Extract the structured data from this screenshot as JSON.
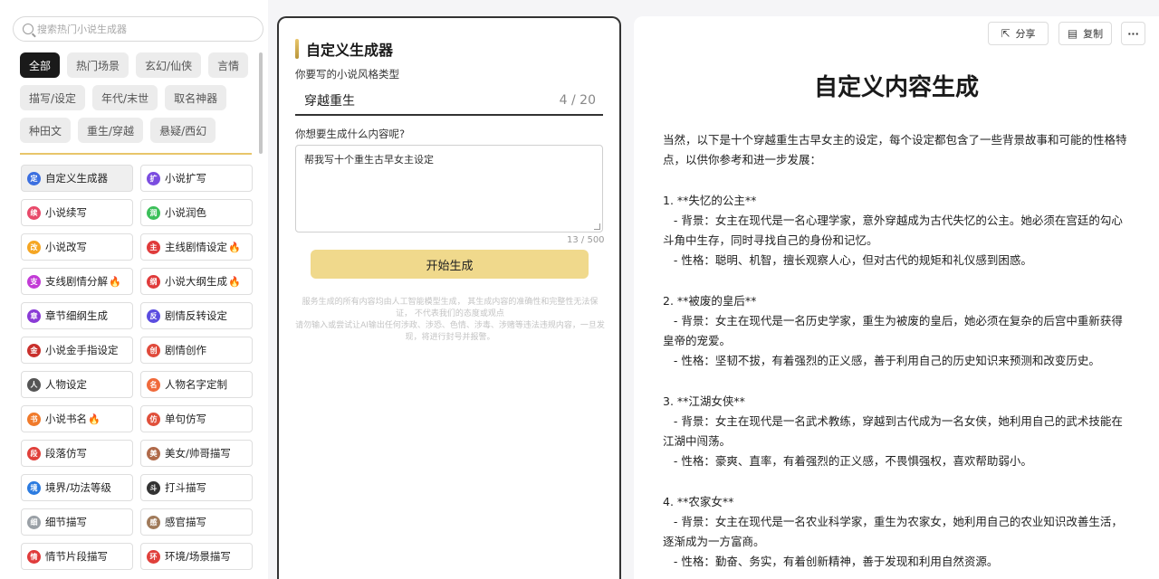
{
  "search": {
    "placeholder": "搜索热门小说生成器"
  },
  "categories": [
    [
      "全部",
      "热门场景",
      "玄幻/仙侠",
      "言情"
    ],
    [
      "描写/设定",
      "年代/末世",
      "取名神器"
    ],
    [
      "种田文",
      "重生/穿越",
      "悬疑/西幻"
    ]
  ],
  "tools": [
    [
      {
        "label": "自定义生成器",
        "icon": "定",
        "color": "#3b6fe0"
      },
      {
        "label": "小说扩写",
        "icon": "扩",
        "color": "#7b4de0"
      }
    ],
    [
      {
        "label": "小说续写",
        "icon": "续",
        "color": "#e84a6a"
      },
      {
        "label": "小说润色",
        "icon": "润",
        "color": "#3cbf5a"
      }
    ],
    [
      {
        "label": "小说改写",
        "icon": "改",
        "color": "#f5a623"
      },
      {
        "label": "主线剧情设定",
        "icon": "主",
        "color": "#e03b3b",
        "fire": "🔥"
      }
    ],
    [
      {
        "label": "支线剧情分解",
        "icon": "支",
        "color": "#c23bd6",
        "fire": "🔥"
      },
      {
        "label": "小说大纲生成",
        "icon": "纲",
        "color": "#e03b3b",
        "fire": "🔥"
      }
    ],
    [
      {
        "label": "章节细纲生成",
        "icon": "章",
        "color": "#8a3bd6"
      },
      {
        "label": "剧情反转设定",
        "icon": "反",
        "color": "#5b4de0"
      }
    ],
    [
      {
        "label": "小说金手指设定",
        "icon": "金",
        "color": "#c9302c"
      },
      {
        "label": "剧情创作",
        "icon": "创",
        "color": "#e04a3b"
      }
    ],
    [
      {
        "label": "人物设定",
        "icon": "人",
        "color": "#555555"
      },
      {
        "label": "人物名字定制",
        "icon": "名",
        "color": "#f06a3b"
      }
    ],
    [
      {
        "label": "小说书名",
        "icon": "书",
        "color": "#f07a2b",
        "fire": "🔥"
      },
      {
        "label": "单句仿写",
        "icon": "仿",
        "color": "#e0503b"
      }
    ],
    [
      {
        "label": "段落仿写",
        "icon": "段",
        "color": "#e0403b"
      },
      {
        "label": "美女/帅哥描写",
        "icon": "美",
        "color": "#b06a4a"
      }
    ],
    [
      {
        "label": "境界/功法等级",
        "icon": "境",
        "color": "#2b7be0"
      },
      {
        "label": "打斗描写",
        "icon": "斗",
        "color": "#333333"
      }
    ],
    [
      {
        "label": "细节描写",
        "icon": "细",
        "color": "#9aa0a6"
      },
      {
        "label": "感官描写",
        "icon": "感",
        "color": "#a07a5a"
      }
    ],
    [
      {
        "label": "情节片段描写",
        "icon": "情",
        "color": "#e03b3b"
      },
      {
        "label": "环境/场景描写",
        "icon": "环",
        "color": "#e0403b"
      }
    ]
  ],
  "generator": {
    "title": "自定义生成器",
    "style_label": "你要写的小说风格类型",
    "style_value": "穿越重生",
    "style_count": "4 / 20",
    "content_label": "你想要生成什么内容呢?",
    "content_value": "帮我写十个重生古早女主设定",
    "content_count": "13 / 500",
    "button": "开始生成",
    "disclaimer1": "服务生成的所有内容均由人工智能模型生成， 其生成内容的准确性和完整性无法保证， 不代表我们的态度或观点",
    "disclaimer2": "请勿输入或尝试让AI输出任何涉政、涉恐、色情、涉毒、涉赌等违法违规内容，一旦发现，将进行封号并报警。"
  },
  "result": {
    "share": "分享",
    "copy": "复制",
    "more": "···",
    "title": "自定义内容生成",
    "body": "当然，以下是十个穿越重生古早女主的设定，每个设定都包含了一些背景故事和可能的性格特点，以供你参考和进一步发展：\n\n1. **失忆的公主**\n   - 背景：女主在现代是一名心理学家，意外穿越成为古代失忆的公主。她必须在宫廷的勾心斗角中生存，同时寻找自己的身份和记忆。\n   - 性格：聪明、机智，擅长观察人心，但对古代的规矩和礼仪感到困惑。\n\n2. **被废的皇后**\n   - 背景：女主在现代是一名历史学家，重生为被废的皇后，她必须在复杂的后宫中重新获得皇帝的宠爱。\n   - 性格：坚韧不拔，有着强烈的正义感，善于利用自己的历史知识来预测和改变历史。\n\n3. **江湖女侠**\n   - 背景：女主在现代是一名武术教练，穿越到古代成为一名女侠，她利用自己的武术技能在江湖中闯荡。\n   - 性格：豪爽、直率，有着强烈的正义感，不畏惧强权，喜欢帮助弱小。\n\n4. **农家女**\n   - 背景：女主在现代是一名农业科学家，重生为农家女，她利用自己的农业知识改善生活，逐渐成为一方富商。\n   - 性格：勤奋、务实，有着创新精神，善于发现和利用自然资源。"
  }
}
